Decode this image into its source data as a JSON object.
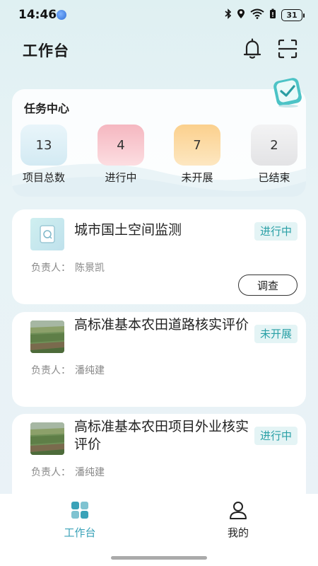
{
  "status_bar": {
    "time": "14:46",
    "battery": "31",
    "icons": [
      "globe-icon",
      "bluetooth-icon",
      "location-icon",
      "wifi-icon",
      "battery-saver-icon",
      "battery-icon"
    ]
  },
  "header": {
    "title": "工作台",
    "icons": [
      "bell-icon",
      "scan-icon"
    ]
  },
  "task_center": {
    "title": "任务中心",
    "stats": [
      {
        "value": "13",
        "label": "项目总数",
        "color": "#dceff6"
      },
      {
        "value": "4",
        "label": "进行中",
        "color": "#f8c9cf"
      },
      {
        "value": "7",
        "label": "未开展",
        "color": "#fbdda8"
      },
      {
        "value": "2",
        "label": "已结束",
        "color": "#e8e8ea"
      }
    ]
  },
  "projects": [
    {
      "name": "城市国土空间监测",
      "status": "进行中",
      "owner_label": "负责人：",
      "owner": "陈景凯",
      "action": "调查",
      "thumb": "document-icon"
    },
    {
      "name": "高标准基本农田道路核实评价",
      "status": "未开展",
      "owner_label": "负责人：",
      "owner": "潘纯建",
      "thumb": "farmland-photo"
    },
    {
      "name": "高标准基本农田项目外业核实评价",
      "status": "进行中",
      "owner_label": "负责人：",
      "owner": "潘纯建",
      "thumb": "farmland-photo"
    }
  ],
  "tabbar": {
    "tabs": [
      {
        "label": "工作台",
        "icon": "grid-icon",
        "active": true
      },
      {
        "label": "我的",
        "icon": "user-icon",
        "active": false
      }
    ],
    "accent": "#3aa2b8"
  }
}
